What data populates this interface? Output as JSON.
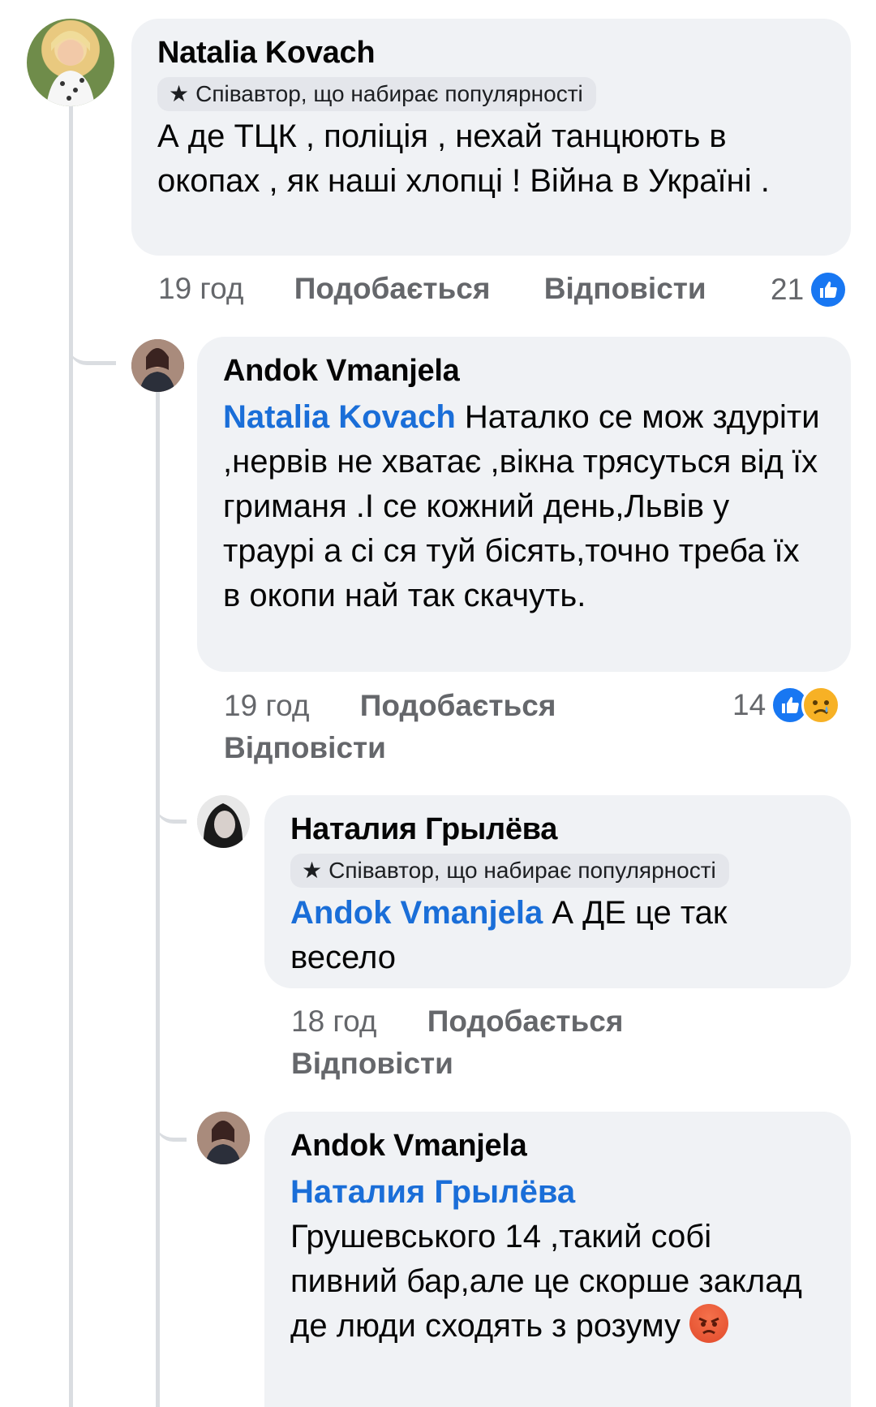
{
  "comments": [
    {
      "author": "Natalia Kovach",
      "badge": "Співавтор, що набирає популярності",
      "text": "А де  ТЦК , поліція , нехай танцюють в окопах , як наші хлопці ! Війна в Україні .",
      "time": "19 год",
      "like_label": "Подобається",
      "reply_label": "Відповісти",
      "reaction_count": "21"
    },
    {
      "author": "Andok Vmanjela",
      "mention": "Natalia Kovach",
      "text": " Наталко се мож здуріти ,нервів не хватає ,вікна трясуться від їх гриманя .І се кожний день,Львів у траурі а сі ся туй бісять,точно треба їх в окопи най так скачуть.",
      "time": "19 год",
      "like_label": "Подобається",
      "reply_label": "Відповісти",
      "reaction_count": "14"
    },
    {
      "author": "Наталия Грылёва",
      "badge": "Співавтор, що набирає популярності",
      "mention": "Andok Vmanjela",
      "text": " А ДЕ це так весело",
      "time": "18 год",
      "like_label": "Подобається",
      "reply_label": "Відповісти"
    },
    {
      "author": "Andok Vmanjela",
      "mention": "Наталия Грылёва",
      "text": "Грушевського 14 ,такий собі пивний бар,але це скорше заклад де люди сходять з розуму"
    }
  ],
  "icons": {
    "badge_icon": "star-icon",
    "like_reaction": "like-icon",
    "sad_reaction": "sad-icon",
    "inline_emoji": "angry-face-icon"
  },
  "colors": {
    "mention": "#1a6ed8",
    "bubble": "#f0f2f5",
    "meta_text": "#65676b",
    "like_blue": "#1877f2"
  }
}
